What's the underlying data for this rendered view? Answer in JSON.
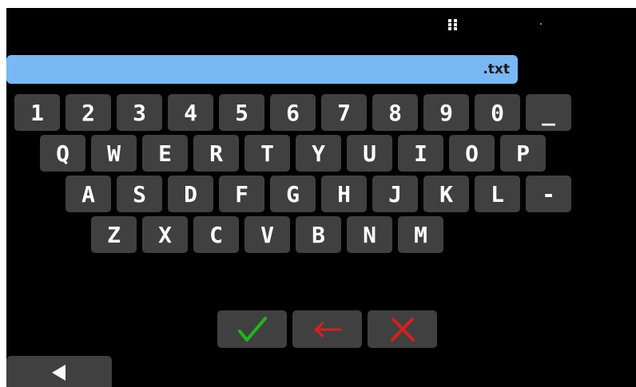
{
  "filename_field": {
    "value": ".txt"
  },
  "keyboard": {
    "row1": [
      "1",
      "2",
      "3",
      "4",
      "5",
      "6",
      "7",
      "8",
      "9",
      "0",
      "_"
    ],
    "row2": [
      "Q",
      "W",
      "E",
      "R",
      "T",
      "Y",
      "U",
      "I",
      "O",
      "P"
    ],
    "row3": [
      "A",
      "S",
      "D",
      "F",
      "G",
      "H",
      "J",
      "K",
      "L",
      "-"
    ],
    "row4": [
      "Z",
      "X",
      "C",
      "V",
      "B",
      "N",
      "M"
    ]
  },
  "actions": {
    "confirm_icon": "checkmark-icon",
    "backspace_icon": "left-arrow-icon",
    "cancel_icon": "x-mark-icon",
    "back_icon": "triangle-left-icon"
  },
  "colors": {
    "field": "#7ab8f5",
    "key": "#404040",
    "confirm": "#1db81d",
    "backspace": "#d42020",
    "cancel": "#d42020"
  }
}
